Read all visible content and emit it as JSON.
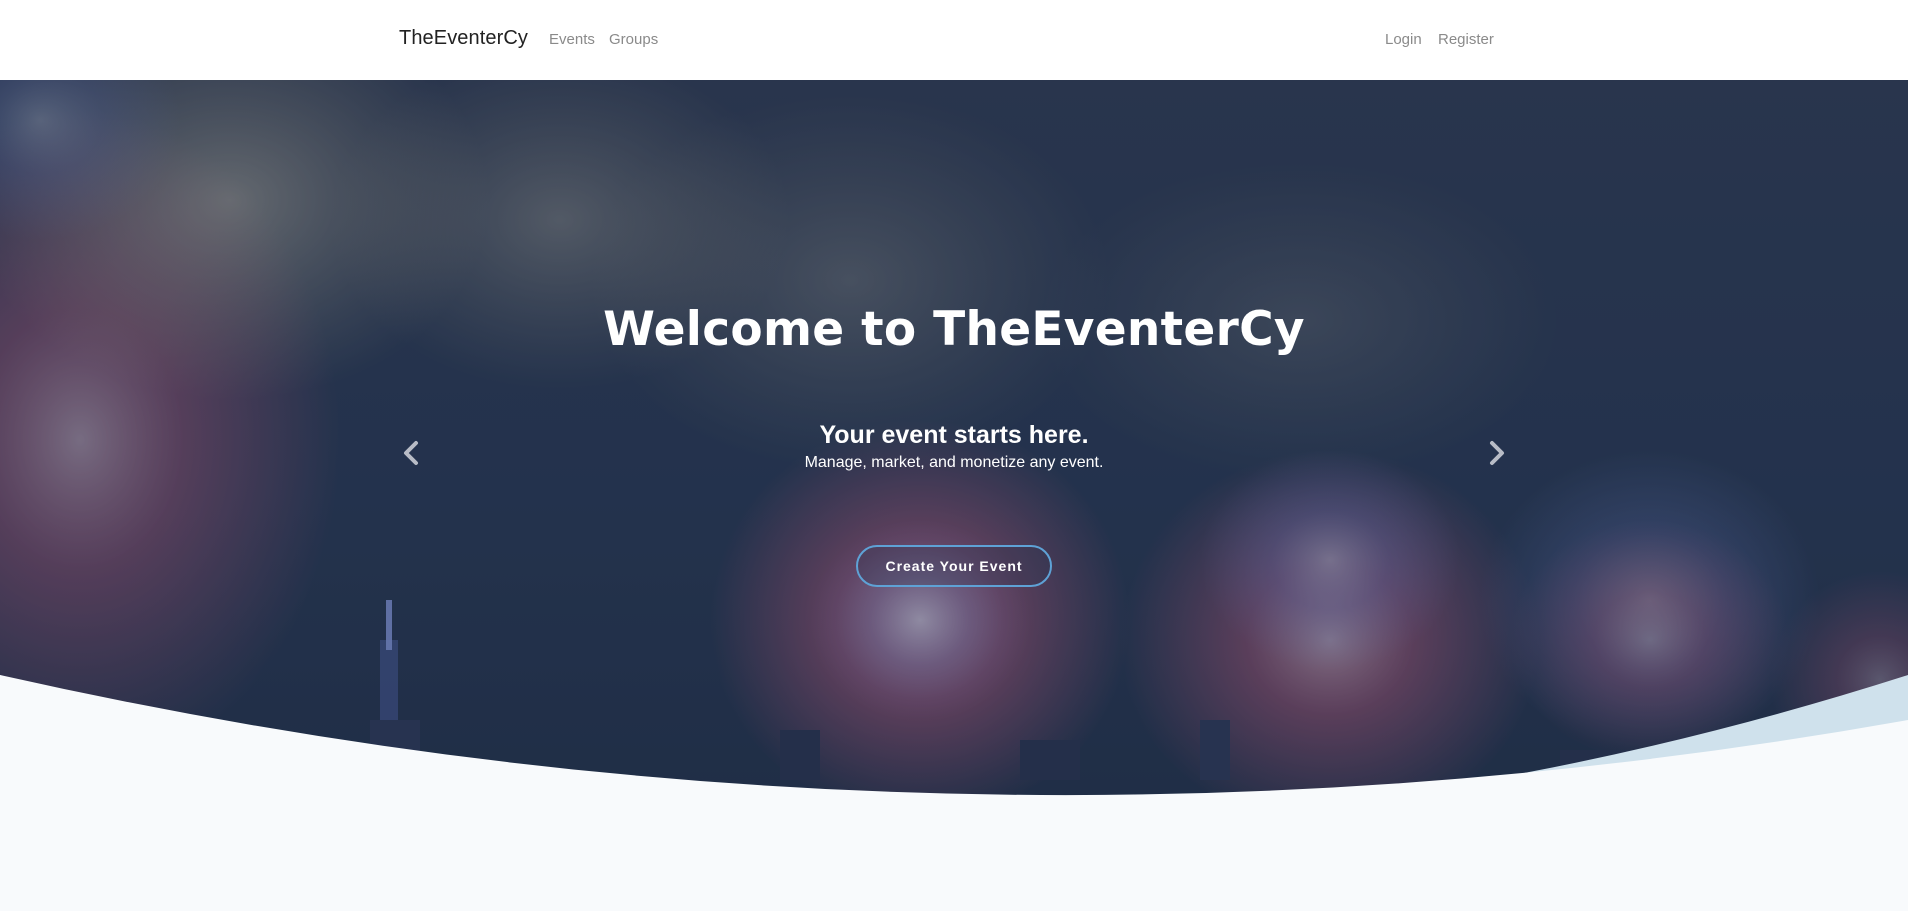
{
  "navbar": {
    "brand": "TheEventerCy",
    "links": [
      {
        "label": "Events"
      },
      {
        "label": "Groups"
      }
    ],
    "auth": [
      {
        "label": "Login"
      },
      {
        "label": "Register"
      }
    ]
  },
  "hero": {
    "title": "Welcome to TheEventerCy",
    "subtitle": "Your event starts here.",
    "tagline": "Manage, market, and monetize any event.",
    "cta_label": "Create Your Event",
    "prev_icon": "chevron-left-icon",
    "next_icon": "chevron-right-icon"
  },
  "colors": {
    "navbar_bg": "#ffffff",
    "hero_overlay": "#1f2f4a",
    "wave_light": "#cfe1ec",
    "page_bg": "#f8fafc",
    "cta_border": "#5ea2d6"
  }
}
